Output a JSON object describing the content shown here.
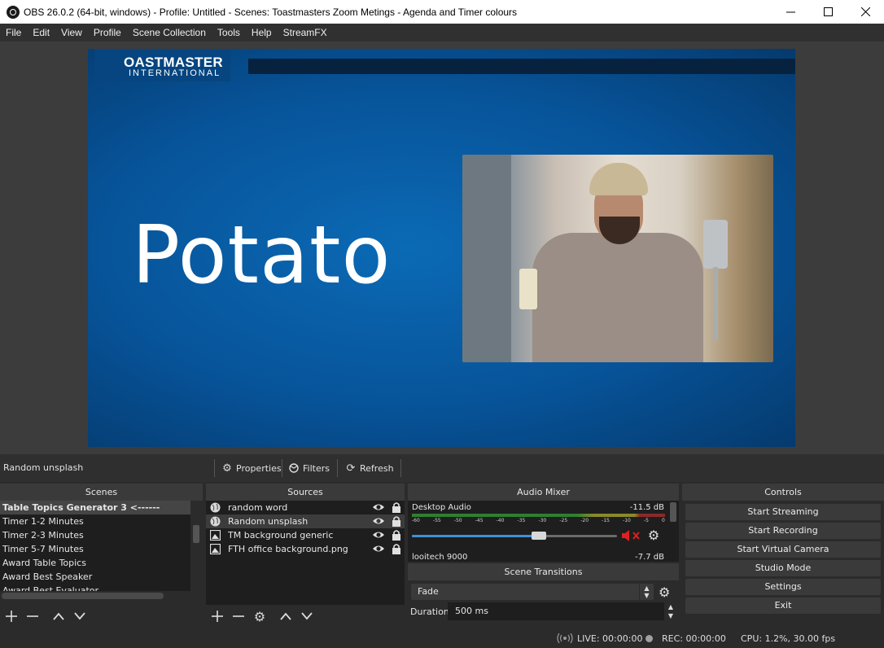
{
  "window": {
    "title": "OBS 26.0.2 (64-bit, windows) - Profile: Untitled - Scenes: Toastmasters Zoom Metings  - Agenda and Timer colours",
    "minimize": "—",
    "maximize": "☐",
    "close": "✕"
  },
  "menu": [
    "File",
    "Edit",
    "View",
    "Profile",
    "Scene Collection",
    "Tools",
    "Help",
    "StreamFX"
  ],
  "preview": {
    "logo_main": "OASTMASTER",
    "logo_sub": "INTERNATIONAL",
    "big_word": "Potato"
  },
  "source_toolbar": {
    "current_source": "Random unsplash",
    "properties": "Properties",
    "filters": "Filters",
    "refresh": "Refresh"
  },
  "scenes": {
    "header": "Scenes",
    "items": [
      "Table Topics Generator 3 <------",
      "Timer 1-2 Minutes",
      "Timer 2-3 Minutes",
      "Timer 5-7 Minutes",
      "Award Table Topics",
      "Award Best Speaker",
      "Award Best Evaluator"
    ]
  },
  "sources": {
    "header": "Sources",
    "items": [
      {
        "name": "random word",
        "type": "browser"
      },
      {
        "name": "Random unsplash",
        "type": "browser"
      },
      {
        "name": "TM background generic",
        "type": "image"
      },
      {
        "name": "FTH  office background.png",
        "type": "image"
      }
    ]
  },
  "audio_mixer": {
    "header": "Audio Mixer",
    "channels": [
      {
        "name": "Desktop Audio",
        "db": "-11.5 dB",
        "volume_fraction": 0.62,
        "muted": true
      },
      {
        "name": "looitech 9000",
        "db": "-7.7 dB"
      }
    ],
    "scale": [
      "-60",
      "-55",
      "-50",
      "-45",
      "-40",
      "-35",
      "-30",
      "-25",
      "-20",
      "-15",
      "-10",
      "-5",
      "0"
    ]
  },
  "transitions": {
    "header": "Scene Transitions",
    "selected": "Fade",
    "duration_label": "Duration",
    "duration_value": "500 ms"
  },
  "controls": {
    "header": "Controls",
    "buttons": [
      "Start Streaming",
      "Start Recording",
      "Start Virtual Camera",
      "Studio Mode",
      "Settings",
      "Exit"
    ]
  },
  "status": {
    "live": "LIVE: 00:00:00",
    "rec": "REC: 00:00:00",
    "cpu": "CPU: 1.2%, 30.00 fps"
  },
  "colors": {
    "accent_blue": "#3f90d6",
    "dock_bg": "#2b2b2b",
    "list_bg": "#1e1e1e",
    "mute_red": "#e02020"
  }
}
